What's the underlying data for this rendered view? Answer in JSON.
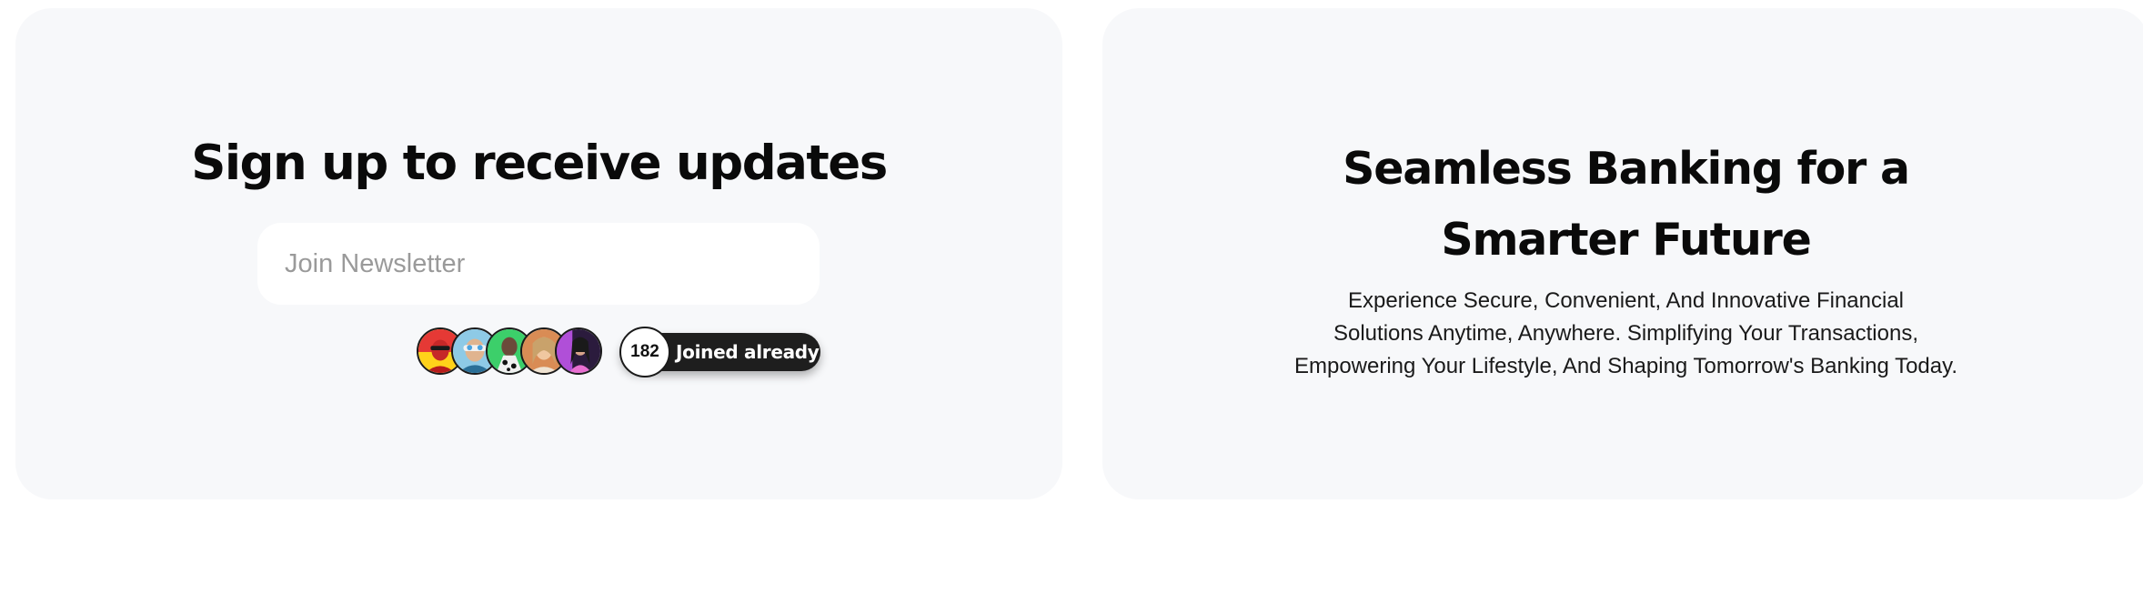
{
  "newsletter": {
    "title": "Sign up to receive updates",
    "input_placeholder": "Join Newsletter",
    "input_value": "",
    "avatars": [
      {
        "icon": "avatar-red-icon",
        "color": "#e53935"
      },
      {
        "icon": "avatar-blue-icon",
        "color": "#4aa3df"
      },
      {
        "icon": "avatar-green-icon",
        "color": "#3ccf6a"
      },
      {
        "icon": "avatar-orange-icon",
        "color": "#d98c55"
      },
      {
        "icon": "avatar-purple-icon",
        "color": "#b04fd8"
      }
    ],
    "joined_count": "182",
    "joined_label": "Joined already"
  },
  "banking": {
    "title_line1": "Seamless Banking for a",
    "title_line2": "Smarter Future",
    "desc_line1": "Experience Secure, Convenient, And Innovative Financial",
    "desc_line2": "Solutions Anytime, Anywhere. Simplifying Your Transactions,",
    "desc_line3": "Empowering Your Lifestyle, And Shaping Tomorrow's Banking Today."
  },
  "colors": {
    "card_background": "#f7f8fa",
    "pill_background": "#1e1e1e",
    "text_primary": "#0a0a0a",
    "placeholder": "#9a9a9a"
  }
}
